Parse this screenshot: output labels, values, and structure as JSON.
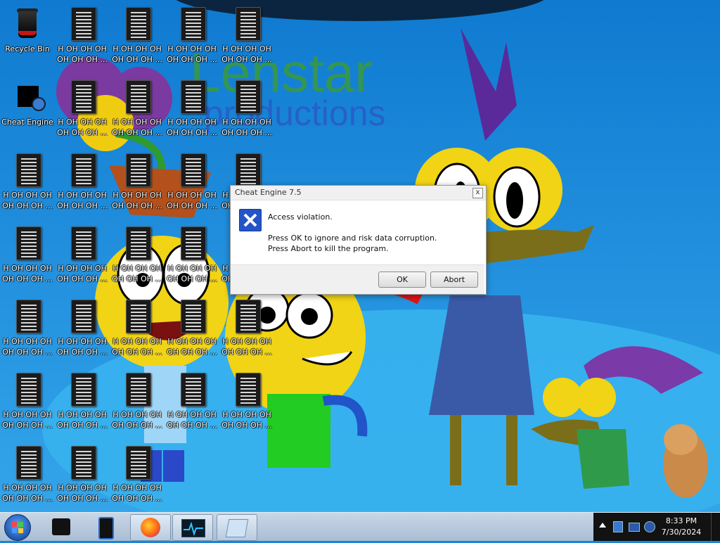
{
  "desktop": {
    "wallpaper_text_line1": "Lenstar",
    "wallpaper_text_line2": "productions",
    "recycle_bin_label": "Recycle Bin",
    "cheat_engine_label": "Cheat Engine",
    "file_icon_label": "H OH OH OH OH OH OH ..."
  },
  "dialog": {
    "title": "Cheat Engine 7.5",
    "close_glyph": "x",
    "icon_glyph": "X",
    "message_title": "Access violation.",
    "message_line1": "Press OK to ignore and risk data corruption.",
    "message_line2": "Press Abort to kill the program.",
    "ok_label": "OK",
    "abort_label": "Abort"
  },
  "taskbar": {
    "items": [
      "Cheat Engine",
      "Tablet",
      "Firefox",
      "Monitor",
      "Notepad"
    ],
    "time": "8:33 PM",
    "date": "7/30/2024"
  }
}
